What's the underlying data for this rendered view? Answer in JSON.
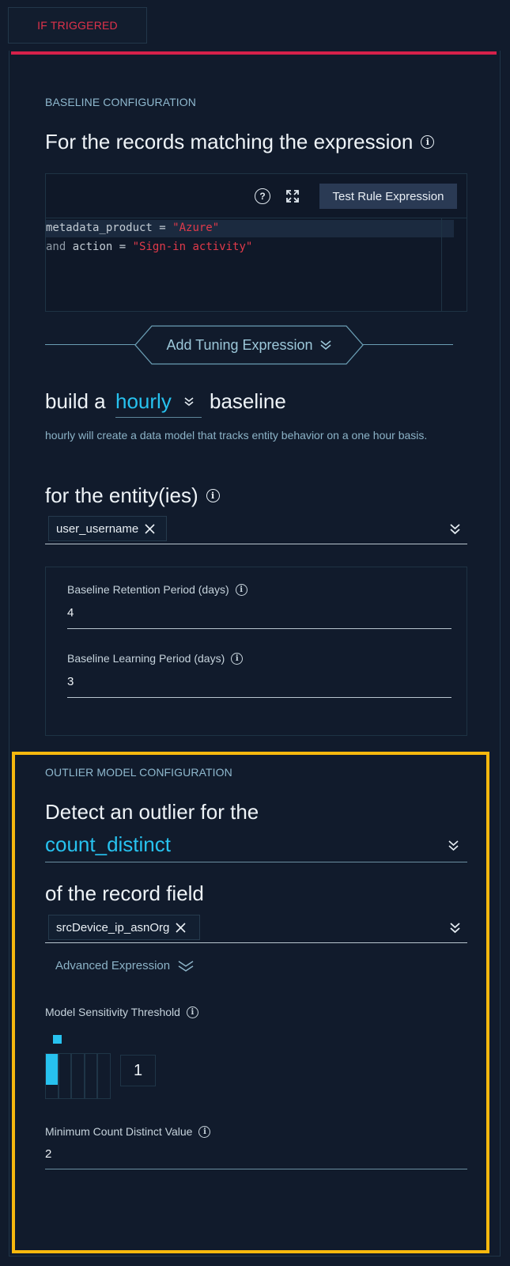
{
  "tab": {
    "label": "IF TRIGGERED"
  },
  "baseline": {
    "section_label": "BASELINE CONFIGURATION",
    "records_heading": "For the records matching the expression",
    "help_icon": "question-circle-icon",
    "expand_icon": "expand-arrows-icon",
    "test_button": "Test Rule Expression",
    "code": {
      "line1_field": "metadata_product",
      "line1_op": " = ",
      "line1_value": "\"Azure\"",
      "line2_kw": "and",
      "line2_field": " action",
      "line2_op": " = ",
      "line2_value": "\"Sign-in activity\""
    },
    "tuning_button": "Add Tuning Expression",
    "build_prefix": "build a",
    "build_value": "hourly",
    "build_suffix": "baseline",
    "build_description": "hourly will create a data model that tracks entity behavior on a one hour basis.",
    "entity_heading": "for the entity(ies)",
    "entity_chip": "user_username",
    "retention_label": "Baseline Retention Period (days)",
    "retention_value": "4",
    "learning_label": "Baseline Learning Period (days)",
    "learning_value": "3"
  },
  "outlier": {
    "section_label": "OUTLIER MODEL CONFIGURATION",
    "detect_heading": "Detect an outlier for the",
    "function_value": "count_distinct",
    "record_field_heading": "of the record field",
    "field_chip": "srcDevice_ip_asnOrg",
    "advanced_label": "Advanced Expression",
    "sensitivity_label": "Model Sensitivity Threshold",
    "sensitivity_value": "1",
    "sensitivity_level": 1,
    "sensitivity_max": 5,
    "min_count_label": "Minimum Count Distinct Value",
    "min_count_value": "2"
  },
  "colors": {
    "accent": "#27c2ef",
    "alert": "#d6214a",
    "highlight_frame": "#f7b80e"
  }
}
